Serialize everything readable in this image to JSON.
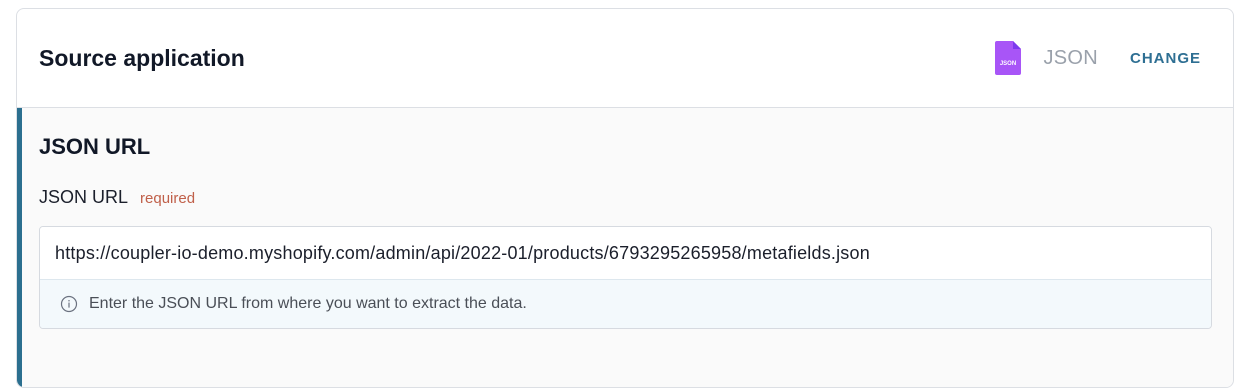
{
  "header": {
    "title": "Source application",
    "app_icon_text": "JSON",
    "app_name": "JSON",
    "change_label": "CHANGE"
  },
  "section": {
    "title": "JSON URL",
    "field_label": "JSON URL",
    "required_label": "required",
    "url_value": "https://coupler-io-demo.myshopify.com/admin/api/2022-01/products/6793295265958/metafields.json",
    "hint": "Enter the JSON URL from where you want to extract the data."
  },
  "icons": {
    "app": "json-file-icon",
    "hint": "info-icon"
  },
  "colors": {
    "accent": "#2b6f8f",
    "change_link": "#2e6f93",
    "required": "#c0604a",
    "json_icon": "#a855f7"
  }
}
